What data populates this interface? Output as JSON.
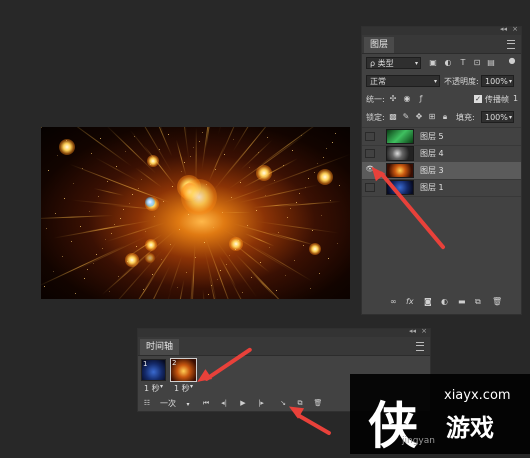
{
  "layers_panel": {
    "tab_label": "图层",
    "filter_kind": "ρ 类型",
    "blend_mode": "正常",
    "opacity_label": "不透明度:",
    "opacity_value": "100%",
    "unify_label": "统一:",
    "propagate_label": "传播帧",
    "propagate_value": "1",
    "propagate_checked": true,
    "lock_label": "锁定:",
    "fill_label": "填充:",
    "fill_value": "100%",
    "layers": [
      {
        "name": "图层 5",
        "visible": false,
        "selected": false,
        "thumb_color": "#1a7a2a"
      },
      {
        "name": "图层 4",
        "visible": false,
        "selected": false,
        "thumb_color": "#444444"
      },
      {
        "name": "图层 3",
        "visible": true,
        "selected": true,
        "thumb_color": "#b0400c"
      },
      {
        "name": "图层 1",
        "visible": false,
        "selected": false,
        "thumb_color": "#1c2f6a"
      }
    ],
    "footer_icons": [
      "link-icon",
      "fx-icon",
      "mask-icon",
      "adjustment-icon",
      "folder-icon",
      "new-layer-icon",
      "trash-icon"
    ]
  },
  "timeline_panel": {
    "tab_label": "时间轴",
    "frames": [
      {
        "number": "1",
        "delay": "1 秒",
        "thumb_color": "#1c2f6a"
      },
      {
        "number": "2",
        "delay": "1 秒",
        "thumb_color": "#b0400c"
      }
    ],
    "loop_label": "一次",
    "icons": [
      "convert-icon",
      "first-frame-icon",
      "prev-frame-icon",
      "play-icon",
      "next-frame-icon",
      "tween-icon",
      "duplicate-frame-icon",
      "trash-icon"
    ]
  },
  "watermark": {
    "logo_char": "侠",
    "site": "xiayx.com",
    "text": "游戏",
    "sub": "jingyan"
  },
  "colors": {
    "panel_bg": "#424242",
    "app_bg": "#282828",
    "arrow": "#e8413a"
  }
}
